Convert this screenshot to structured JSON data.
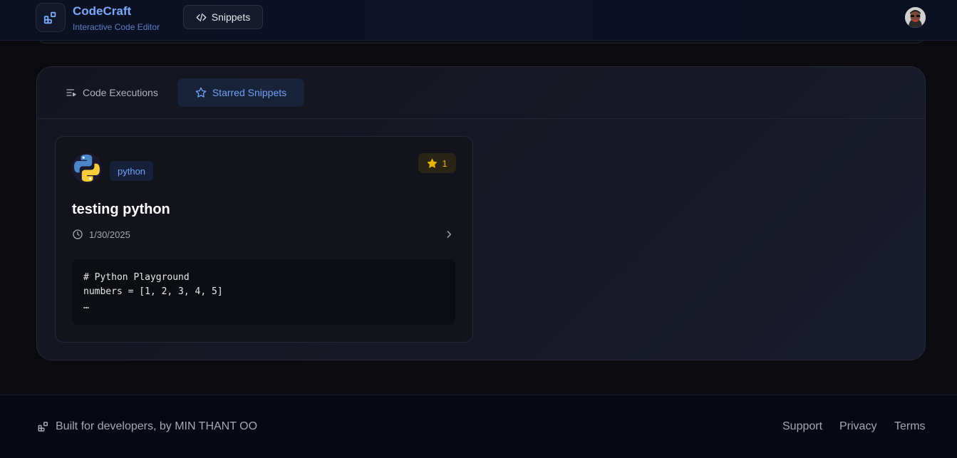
{
  "header": {
    "brand_title": "CodeCraft",
    "brand_subtitle": "Interactive Code Editor",
    "snippets_label": "Snippets"
  },
  "tabs": [
    {
      "label": "Code Executions",
      "icon": "list-play-icon",
      "active": false
    },
    {
      "label": "Starred Snippets",
      "icon": "star-icon",
      "active": true
    }
  ],
  "snippet": {
    "language": "python",
    "star_count": "1",
    "title": "testing python",
    "date": "1/30/2025",
    "code_lines": [
      "# Python Playground",
      "numbers = [1, 2, 3, 4, 5]",
      "…"
    ]
  },
  "footer": {
    "credit": "Built for developers, by MIN THANT OO",
    "links": [
      "Support",
      "Privacy",
      "Terms"
    ]
  },
  "colors": {
    "accent": "#6fa2f3",
    "star": "#eab308",
    "background": "#0a0a0f"
  }
}
